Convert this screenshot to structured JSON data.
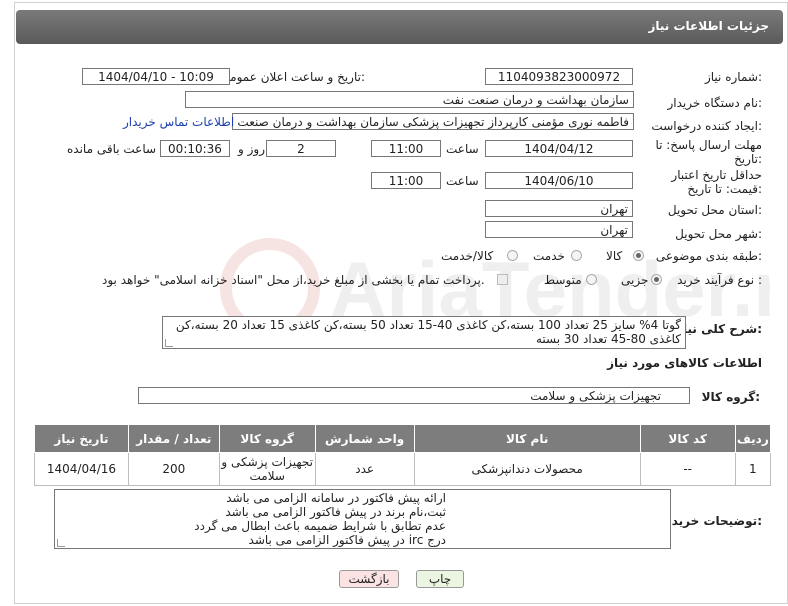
{
  "header": {
    "title": "جزئیات اطلاعات نیاز"
  },
  "fields": {
    "need_number_label": "شماره نیاز:",
    "need_number": "1104093823000972",
    "announce_label": "تاریخ و ساعت اعلان عمومی:",
    "announce_value": "1404/04/10 - 10:09",
    "buyer_org_label": "نام دستگاه خریدار:",
    "buyer_org": "سازمان بهداشت و درمان صنعت نفت",
    "creator_label": "ایجاد کننده درخواست:",
    "creator": "فاطمه نوری مؤمنی کارپرداز تجهیزات پزشکی سازمان بهداشت و درمان صنعت نف",
    "contact_link": "اطلاعات تماس خریدار",
    "deadline_label": "مهلت ارسال پاسخ: تا تاریخ:",
    "deadline_date": "1404/04/12",
    "time_word": "ساعت",
    "deadline_time": "11:00",
    "days_value": "2",
    "days_word": "روز و",
    "remaining_time": "00:10:36",
    "remaining_word": "ساعت باقی مانده",
    "price_validity_label": "حداقل تاریخ اعتبار قیمت: تا تاریخ:",
    "price_validity_date": "1404/06/10",
    "price_validity_time": "11:00",
    "province_label": "استان محل تحویل:",
    "province": "تهران",
    "city_label": "شهر محل تحویل:",
    "city": "تهران",
    "category_label": "طبقه بندی موضوعی:",
    "category_options": [
      "کالا",
      "خدمت",
      "کالا/خدمت"
    ],
    "category_selected": "کالا",
    "process_label": "نوع فرآیند خرید :",
    "process_options": [
      "جزیی",
      "متوسط"
    ],
    "process_selected": "جزیی",
    "payment_note": "پرداخت تمام یا بخشی از مبلغ خرید،از محل \"اسناد خزانه اسلامی\" خواهد بود.",
    "description_label": "شرح کلی نیاز:",
    "description": "گوتا 4% سایز 25 تعداد 100 بسته،کن کاغذی 40-15 تعداد 50 بسته،کن کاغذی 15 تعداد 20 بسته،کن کاغذی 80-45 تعداد 30 بسته"
  },
  "goods": {
    "section_title": "اطلاعات کالاهای مورد نیاز",
    "group_label": "گروه کالا:",
    "group_value": "تجهیزات پزشکی و سلامت",
    "columns": [
      "ردیف",
      "کد کالا",
      "نام کالا",
      "واحد شمارش",
      "گروه کالا",
      "تعداد / مقدار",
      "تاریخ نیاز"
    ],
    "rows": [
      {
        "row": "1",
        "code": "--",
        "name": "محصولات دندانپزشکی",
        "unit": "عدد",
        "group": "تجهیزات پزشکی و سلامت",
        "qty": "200",
        "date": "1404/04/16"
      }
    ]
  },
  "buyer_notes": {
    "label": "توضیحات خریدار:",
    "lines": [
      "ارائه پیش فاکتور در سامانه الزامی می باشد",
      "ثبت،نام برند در پیش فاکتور الزامی می باشد",
      "عدم تطابق با شرایط ضمیمه باعث ابطال می گردد",
      "درج irc در پیش فاکتور الزامی می باشد"
    ]
  },
  "buttons": {
    "print": "چاپ",
    "back": "بازگشت"
  },
  "colors": {
    "header_bg": "#666666",
    "link": "#1a3fb0",
    "back_btn": "#fbe4e4",
    "print_btn": "#e8f5e0"
  }
}
